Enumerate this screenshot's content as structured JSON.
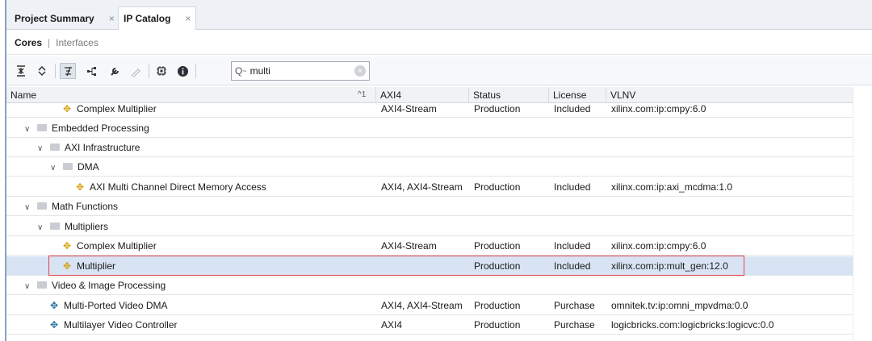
{
  "tabs": [
    {
      "label": "Project Summary",
      "active": false
    },
    {
      "label": "IP Catalog",
      "active": true
    }
  ],
  "close_glyph": "×",
  "subnav": {
    "active": "Cores",
    "separator": "|",
    "inactive": "Interfaces"
  },
  "toolbar": {
    "icons": [
      "collapse-all-icon",
      "expand-all-icon",
      "filter-icon",
      "hierarchy-icon",
      "customize-ip-icon",
      "edit-ip-icon",
      "chip-icon",
      "info-icon"
    ],
    "search": {
      "value": "multi",
      "icon_glyph": "Q",
      "dropdown_glyph": "~"
    }
  },
  "columns": {
    "name": "Name",
    "sort_indicator": "^1",
    "axi4": "AXI4",
    "status": "Status",
    "license": "License",
    "vlnv": "VLNV"
  },
  "rows": [
    {
      "type": "ip",
      "icon": "yellow",
      "name": "Complex Multiplier",
      "axi4": "AXI4-Stream",
      "status": "Production",
      "license": "Included",
      "vlnv": "xilinx.com:ip:cmpy:6.0"
    },
    {
      "type": "folder",
      "name": "Embedded Processing"
    },
    {
      "type": "folder",
      "name": "AXI Infrastructure"
    },
    {
      "type": "folder",
      "name": "DMA"
    },
    {
      "type": "ip",
      "icon": "yellow",
      "name": "AXI Multi Channel Direct Memory Access",
      "axi4": "AXI4, AXI4-Stream",
      "status": "Production",
      "license": "Included",
      "vlnv": "xilinx.com:ip:axi_mcdma:1.0"
    },
    {
      "type": "folder",
      "name": "Math Functions"
    },
    {
      "type": "folder",
      "name": "Multipliers"
    },
    {
      "type": "ip",
      "icon": "yellow",
      "name": "Complex Multiplier",
      "axi4": "AXI4-Stream",
      "status": "Production",
      "license": "Included",
      "vlnv": "xilinx.com:ip:cmpy:6.0"
    },
    {
      "type": "ip",
      "icon": "yellow",
      "name": "Multiplier",
      "axi4": "",
      "status": "Production",
      "license": "Included",
      "vlnv": "xilinx.com:ip:mult_gen:12.0",
      "selected": true
    },
    {
      "type": "folder",
      "name": "Video & Image Processing"
    },
    {
      "type": "ip",
      "icon": "blue",
      "name": "Multi-Ported Video DMA",
      "axi4": "AXI4, AXI4-Stream",
      "status": "Production",
      "license": "Purchase",
      "vlnv": "omnitek.tv:ip:omni_mpvdma:0.0"
    },
    {
      "type": "ip",
      "icon": "blue",
      "name": "Multilayer Video Controller",
      "axi4": "AXI4",
      "status": "Production",
      "license": "Purchase",
      "vlnv": "logicbricks.com:logicbricks:logicvc:0.0"
    }
  ],
  "colors": {
    "selected_row": "#d8e3f4",
    "highlight_border": "#e0474c",
    "ip_yellow": "#d4a20a",
    "ip_blue": "#1f6e9e"
  }
}
